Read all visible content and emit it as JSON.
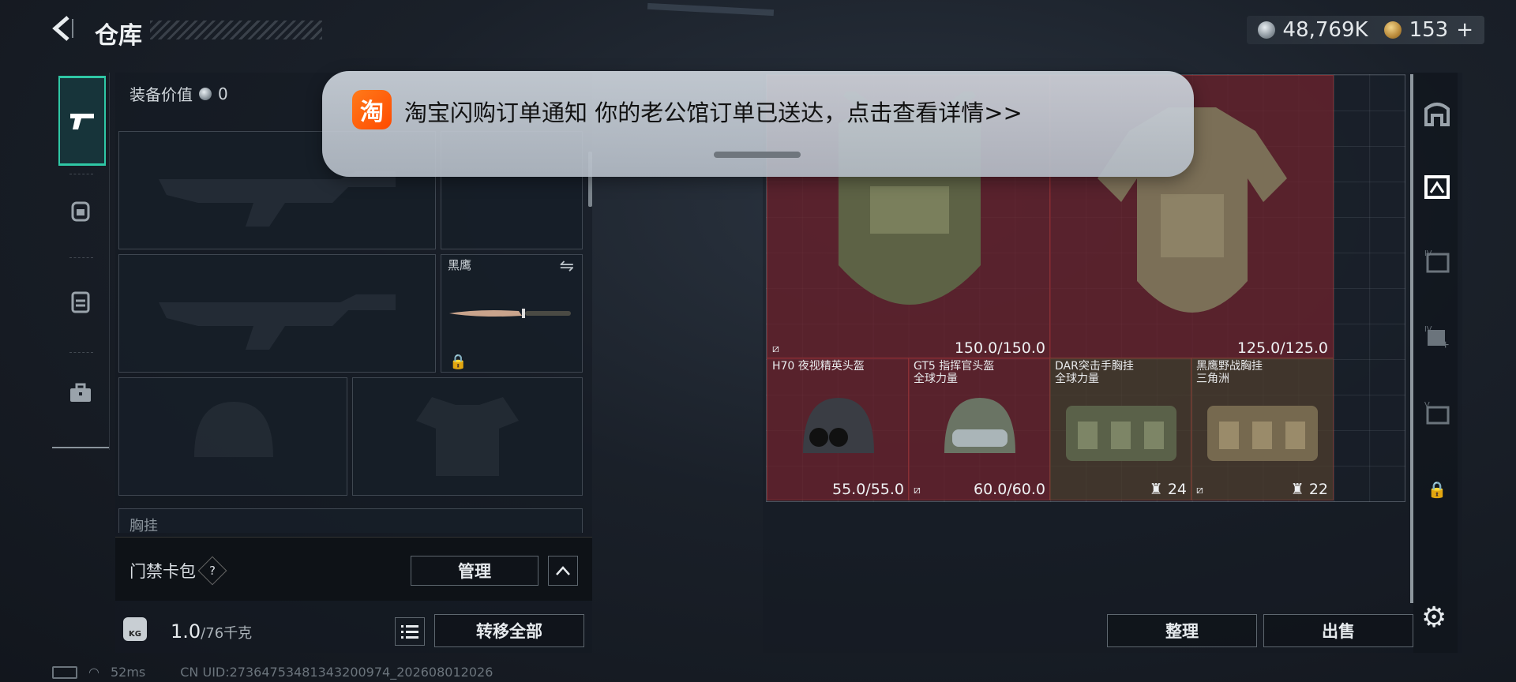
{
  "header": {
    "title": "仓库",
    "currency_silver": "48,769K",
    "currency_gold": "153",
    "add_label": "+"
  },
  "left_panel": {
    "equip_value_label": "装备价值",
    "equip_value": "0",
    "knife_name": "黑鹰",
    "chest_label": "胸挂",
    "card_pack_label": "门禁卡包",
    "help_label": "?",
    "manage_button": "管理",
    "weight_current": "1.0",
    "weight_max": "/76千克",
    "bag_tag": "KG",
    "transfer_all_button": "转移全部"
  },
  "notification": {
    "app_icon_char": "淘",
    "text": "淘宝闪购订单通知 你的老公馆订单已送达，点击查看详情>>"
  },
  "stash_items": [
    {
      "name": "",
      "sub": "",
      "value": "150.0/150.0"
    },
    {
      "name": "",
      "sub": "",
      "value": "125.0/125.0"
    },
    {
      "name": "H70 夜视精英头盔",
      "sub": "",
      "value": "55.0/55.0"
    },
    {
      "name": "GT5 指挥官头盔",
      "sub": "全球力量",
      "value": "60.0/60.0"
    },
    {
      "name": "DAR突击手胸挂",
      "sub": "全球力量",
      "value": "24"
    },
    {
      "name": "黑鹰野战胸挂",
      "sub": "三角洲",
      "value": "22"
    }
  ],
  "right_panel": {
    "organize_button": "整理",
    "sell_button": "出售"
  },
  "status_bar": {
    "ping": "52ms",
    "uid": "CN UID:27364753481343200974_202608012026"
  },
  "colors": {
    "active_tab": "#2fc7a5",
    "item_red": "#6e232d",
    "item_brown": "#4e3e2d",
    "notif_icon": "#ff5a00"
  }
}
